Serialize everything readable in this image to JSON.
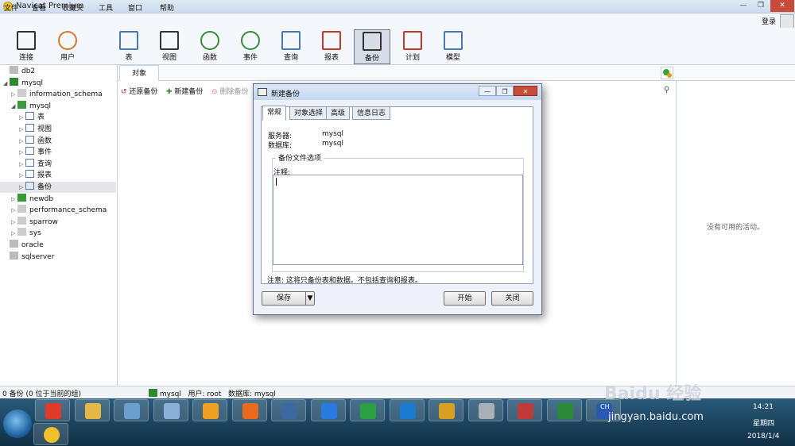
{
  "window": {
    "title": "Navicat Premium"
  },
  "menu": [
    "文件",
    "查看",
    "收藏夹",
    "工具",
    "窗口",
    "帮助"
  ],
  "login": "登录",
  "toolbar": [
    {
      "label": "连接",
      "icon": "connection-icon",
      "color": "#333"
    },
    {
      "label": "用户",
      "icon": "user-icon",
      "color": "#d17b2a"
    },
    {
      "label": "表",
      "icon": "table-icon",
      "color": "#4a78b0"
    },
    {
      "label": "视图",
      "icon": "view-icon",
      "color": "#333"
    },
    {
      "label": "函数",
      "icon": "function-icon",
      "color": "#3a8a3a"
    },
    {
      "label": "事件",
      "icon": "event-icon",
      "color": "#3a8a3a"
    },
    {
      "label": "查询",
      "icon": "query-icon",
      "color": "#4a78b0"
    },
    {
      "label": "报表",
      "icon": "report-icon",
      "color": "#c0392b"
    },
    {
      "label": "备份",
      "icon": "backup-icon",
      "color": "#333"
    },
    {
      "label": "计划",
      "icon": "schedule-icon",
      "color": "#c0392b"
    },
    {
      "label": "模型",
      "icon": "model-icon",
      "color": "#4a78b0"
    }
  ],
  "tree": [
    {
      "label": "db2",
      "icon": "conn-icon",
      "level": 0
    },
    {
      "label": "mysql",
      "icon": "mysql-conn-icon",
      "level": 0,
      "expanded": true
    },
    {
      "label": "information_schema",
      "icon": "db-icon",
      "level": 1
    },
    {
      "label": "mysql",
      "icon": "db-green-icon",
      "level": 1,
      "expanded": true
    },
    {
      "label": "表",
      "icon": "table-icon",
      "level": 2
    },
    {
      "label": "视图",
      "icon": "view-icon",
      "level": 2
    },
    {
      "label": "函数",
      "icon": "function-icon",
      "level": 2
    },
    {
      "label": "事件",
      "icon": "event-icon",
      "level": 2
    },
    {
      "label": "查询",
      "icon": "query-icon",
      "level": 2
    },
    {
      "label": "报表",
      "icon": "report-icon",
      "level": 2
    },
    {
      "label": "备份",
      "icon": "backup-icon",
      "level": 2,
      "selected": true
    },
    {
      "label": "newdb",
      "icon": "db-green-icon",
      "level": 1
    },
    {
      "label": "performance_schema",
      "icon": "db-icon",
      "level": 1
    },
    {
      "label": "sparrow",
      "icon": "db-icon",
      "level": 1
    },
    {
      "label": "sys",
      "icon": "db-icon",
      "level": 1
    },
    {
      "label": "oracle",
      "icon": "conn-icon",
      "level": 0
    },
    {
      "label": "sqlserver",
      "icon": "conn-icon",
      "level": 0
    }
  ],
  "main": {
    "tab": "对象",
    "restore": "还原备份",
    "new_backup": "新建备份",
    "delete_backup": "删除备份"
  },
  "right": {
    "empty": "没有可用的活动。"
  },
  "status": {
    "left": "0 备份 (0 位于当前的组)",
    "conn": "mysql",
    "user": "用户: root",
    "db": "数据库: mysql"
  },
  "dialog": {
    "title": "新建备份",
    "tabs": [
      "常规",
      "对象选择",
      "高级",
      "信息日志"
    ],
    "server_label": "服务器:",
    "server_value": "mysql",
    "db_label": "数据库:",
    "db_value": "mysql",
    "group_title": "备份文件选项",
    "comment_label": "注释:",
    "note": "注意: 这将只备份表和数据。不包括查询和报表。",
    "save": "保存",
    "start": "开始",
    "close": "关闭"
  },
  "taskbar": {
    "time": "14:21",
    "day": "星期四",
    "date": "2018/1/4",
    "lang": "CH",
    "watermark": "jingyan.baidu.com",
    "wm": "Baidu 经验"
  }
}
